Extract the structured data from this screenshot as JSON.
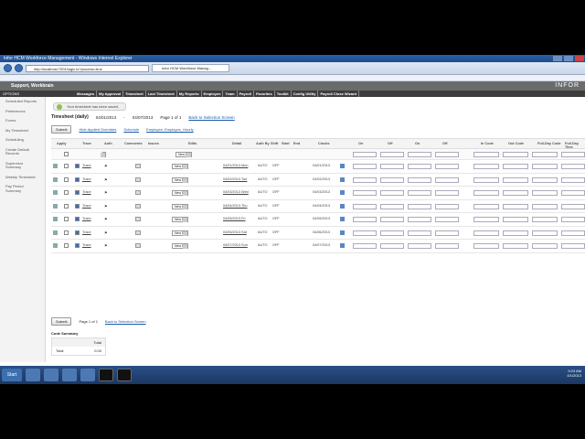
{
  "window": {
    "title": "Infor HCM Workforce Management - Windows Internet Explorer"
  },
  "browser": {
    "url": "http://localhost:7001/logic.tx?process=true",
    "tabs": [
      {
        "label": "Infor HCM Workforce Manag..."
      }
    ]
  },
  "app": {
    "user_header": "Support, Workbrain",
    "logo": "INFOR",
    "options_label": "OPTIONS",
    "menu": [
      "Messages",
      "My Approval",
      "Timesheet",
      "Last Timesheet",
      "My Reports",
      "Employee",
      "Team",
      "Payroll",
      "Favorites",
      "Toolkit",
      "Config Utility",
      "Payroll Close Wizard"
    ]
  },
  "left_nav": [
    "Scheduled Reports",
    "Preferences",
    "Forms",
    "My Timesheet",
    "Scheduling",
    "Create Default Records",
    "Supervisor Summary",
    "Weekly Timesheet",
    "Pay Period Summary"
  ],
  "notice": "Your timesheet has been saved.",
  "timesheet": {
    "title": "Timesheet (daily)",
    "date_from": "04/01/2013",
    "date_to": "04/07/2013",
    "page": "Page 1 of 1",
    "back_link": "Back to Selection Screen",
    "submit": "Submit",
    "hide_overrides": "Hide Applied Overrides",
    "schedule": "Schedule",
    "employee": "Employee: Employee, Hourly"
  },
  "columns": [
    "Apply",
    "Trace",
    "Auth",
    "Comments",
    "Issues",
    "Edits",
    "Detail",
    "Auth By",
    "Shift",
    "Start",
    "End",
    "Clocks",
    "On",
    "Off",
    "On",
    "Off",
    "In Code",
    "Out Code",
    "Full-Day Code",
    "Full-Day Time"
  ],
  "filter_row": {
    "edits": "New Edit"
  },
  "rows": [
    {
      "edit": "New Edit",
      "detail": "04/01/2013 Mon",
      "auth_by": "AUTO",
      "shift": "OFF",
      "clock_date": "04/01/2013",
      "trace": "Trace"
    },
    {
      "edit": "New Edit",
      "detail": "04/02/2013 Tue",
      "auth_by": "AUTO",
      "shift": "OFF",
      "clock_date": "04/02/2013",
      "trace": "Trace"
    },
    {
      "edit": "New Edit",
      "detail": "04/03/2013 Wed",
      "auth_by": "AUTO",
      "shift": "OFF",
      "clock_date": "04/03/2013",
      "trace": "Trace"
    },
    {
      "edit": "New Edit",
      "detail": "04/04/2013 Thu",
      "auth_by": "AUTO",
      "shift": "OFF",
      "clock_date": "04/04/2013",
      "trace": "Trace"
    },
    {
      "edit": "New Edit",
      "detail": "04/05/2013 Fri",
      "auth_by": "AUTO",
      "shift": "OFF",
      "clock_date": "04/05/2013",
      "trace": "Trace"
    },
    {
      "edit": "New Edit",
      "detail": "04/06/2013 Sat",
      "auth_by": "AUTO",
      "shift": "OFF",
      "clock_date": "04/06/2013",
      "trace": "Trace"
    },
    {
      "edit": "New Edit",
      "detail": "04/07/2013 Sun",
      "auth_by": "AUTO",
      "shift": "OFF",
      "clock_date": "04/07/2013",
      "trace": "Trace"
    }
  ],
  "pager": {
    "submit": "Submit",
    "page": "Page 1 of 1",
    "back_link": "Back to Selection Screen"
  },
  "code_summary": {
    "title": "Code Summary",
    "col": "Total",
    "row_label": "Total",
    "row_value": "0.00"
  },
  "taskbar": {
    "start": "Start",
    "time": "9:23 AM",
    "date": "4/1/2013"
  }
}
